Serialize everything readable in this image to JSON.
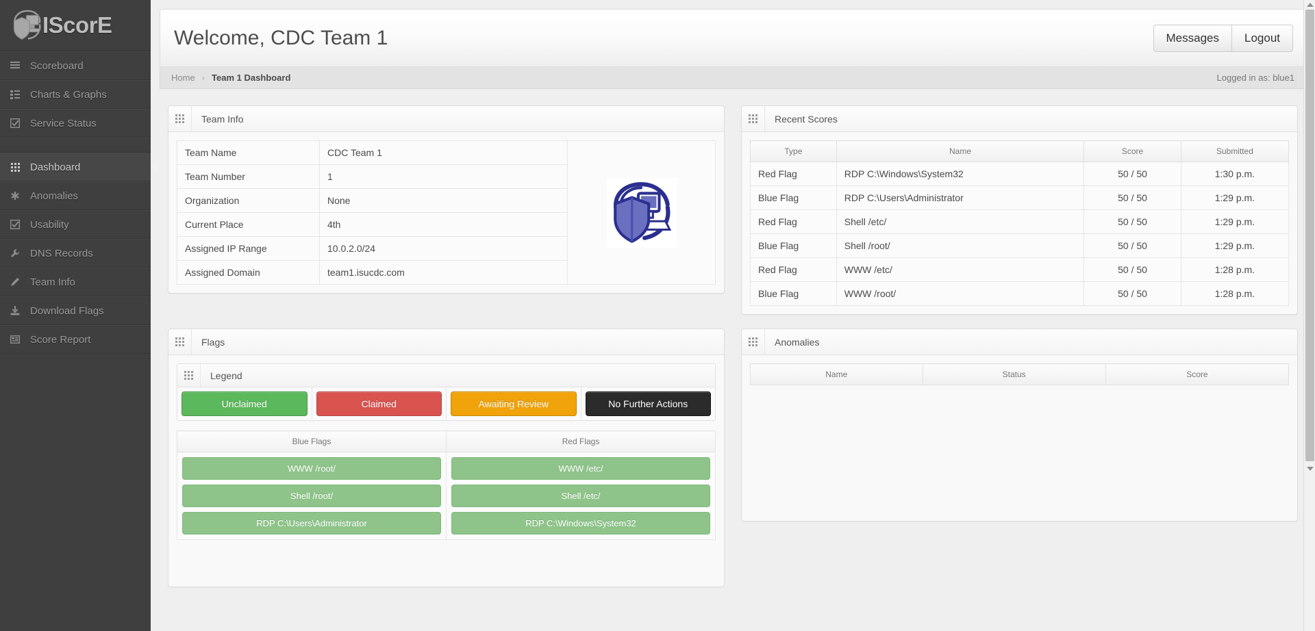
{
  "brand": {
    "name": "IScorE",
    "logo_icon": "shield-computer-logo"
  },
  "sidebar": {
    "items": [
      {
        "label": "Scoreboard",
        "icon": "list-icon",
        "active": false
      },
      {
        "label": "Charts & Graphs",
        "icon": "list-alt-icon",
        "active": false
      },
      {
        "label": "Service Status",
        "icon": "check-square-icon",
        "active": false
      },
      {
        "label": "Dashboard",
        "icon": "grid-icon",
        "active": true
      },
      {
        "label": "Anomalies",
        "icon": "asterisk-icon",
        "active": false
      },
      {
        "label": "Usability",
        "icon": "check-square-icon",
        "active": false
      },
      {
        "label": "DNS Records",
        "icon": "wrench-icon",
        "active": false
      },
      {
        "label": "Team Info",
        "icon": "pencil-icon",
        "active": false
      },
      {
        "label": "Download Flags",
        "icon": "download-icon",
        "active": false
      },
      {
        "label": "Score Report",
        "icon": "report-icon",
        "active": false
      }
    ]
  },
  "topbar": {
    "welcome": "Welcome, CDC Team 1",
    "messages_label": "Messages",
    "logout_label": "Logout"
  },
  "breadcrumb": {
    "home": "Home",
    "separator": "›",
    "current": "Team 1 Dashboard",
    "logged_in_as": "Logged in as: blue1"
  },
  "team_info": {
    "panel_title": "Team Info",
    "rows": [
      {
        "label": "Team Name",
        "value": "CDC Team 1"
      },
      {
        "label": "Team Number",
        "value": "1"
      },
      {
        "label": "Organization",
        "value": "None"
      },
      {
        "label": "Current Place",
        "value": "4th"
      },
      {
        "label": "Assigned IP Range",
        "value": "10.0.2.0/24"
      },
      {
        "label": "Assigned Domain",
        "value": "team1.isucdc.com"
      }
    ],
    "logo_icon": "cdc-shield-computer-logo"
  },
  "recent_scores": {
    "panel_title": "Recent Scores",
    "columns": [
      "Type",
      "Name",
      "Score",
      "Submitted"
    ],
    "rows": [
      {
        "type": "Red Flag",
        "name": "RDP C:\\Windows\\System32",
        "score": "50 / 50",
        "submitted": "1:30 p.m."
      },
      {
        "type": "Blue Flag",
        "name": "RDP C:\\Users\\Administrator",
        "score": "50 / 50",
        "submitted": "1:29 p.m."
      },
      {
        "type": "Red Flag",
        "name": "Shell /etc/",
        "score": "50 / 50",
        "submitted": "1:29 p.m."
      },
      {
        "type": "Blue Flag",
        "name": "Shell /root/",
        "score": "50 / 50",
        "submitted": "1:29 p.m."
      },
      {
        "type": "Red Flag",
        "name": "WWW /etc/",
        "score": "50 / 50",
        "submitted": "1:28 p.m."
      },
      {
        "type": "Blue Flag",
        "name": "WWW /root/",
        "score": "50 / 50",
        "submitted": "1:28 p.m."
      }
    ]
  },
  "flags": {
    "panel_title": "Flags",
    "legend_title": "Legend",
    "legend": [
      {
        "label": "Unclaimed",
        "color": "#5cb85c"
      },
      {
        "label": "Claimed",
        "color": "#d9534f"
      },
      {
        "label": "Awaiting Review",
        "color": "#f0a30a"
      },
      {
        "label": "No Further Actions",
        "color": "#2b2b2b"
      }
    ],
    "columns": [
      "Blue Flags",
      "Red Flags"
    ],
    "blue_flags": [
      {
        "label": "WWW /root/",
        "state": "unclaimed"
      },
      {
        "label": "Shell /root/",
        "state": "unclaimed"
      },
      {
        "label": "RDP C:\\Users\\Administrator",
        "state": "unclaimed"
      }
    ],
    "red_flags": [
      {
        "label": "WWW /etc/",
        "state": "unclaimed"
      },
      {
        "label": "Shell /etc/",
        "state": "unclaimed"
      },
      {
        "label": "RDP C:\\Windows\\System32",
        "state": "unclaimed"
      }
    ],
    "flag_color": "#8ec48a"
  },
  "anomalies": {
    "panel_title": "Anomalies",
    "columns": [
      "Name",
      "Status",
      "Score"
    ],
    "rows": []
  }
}
